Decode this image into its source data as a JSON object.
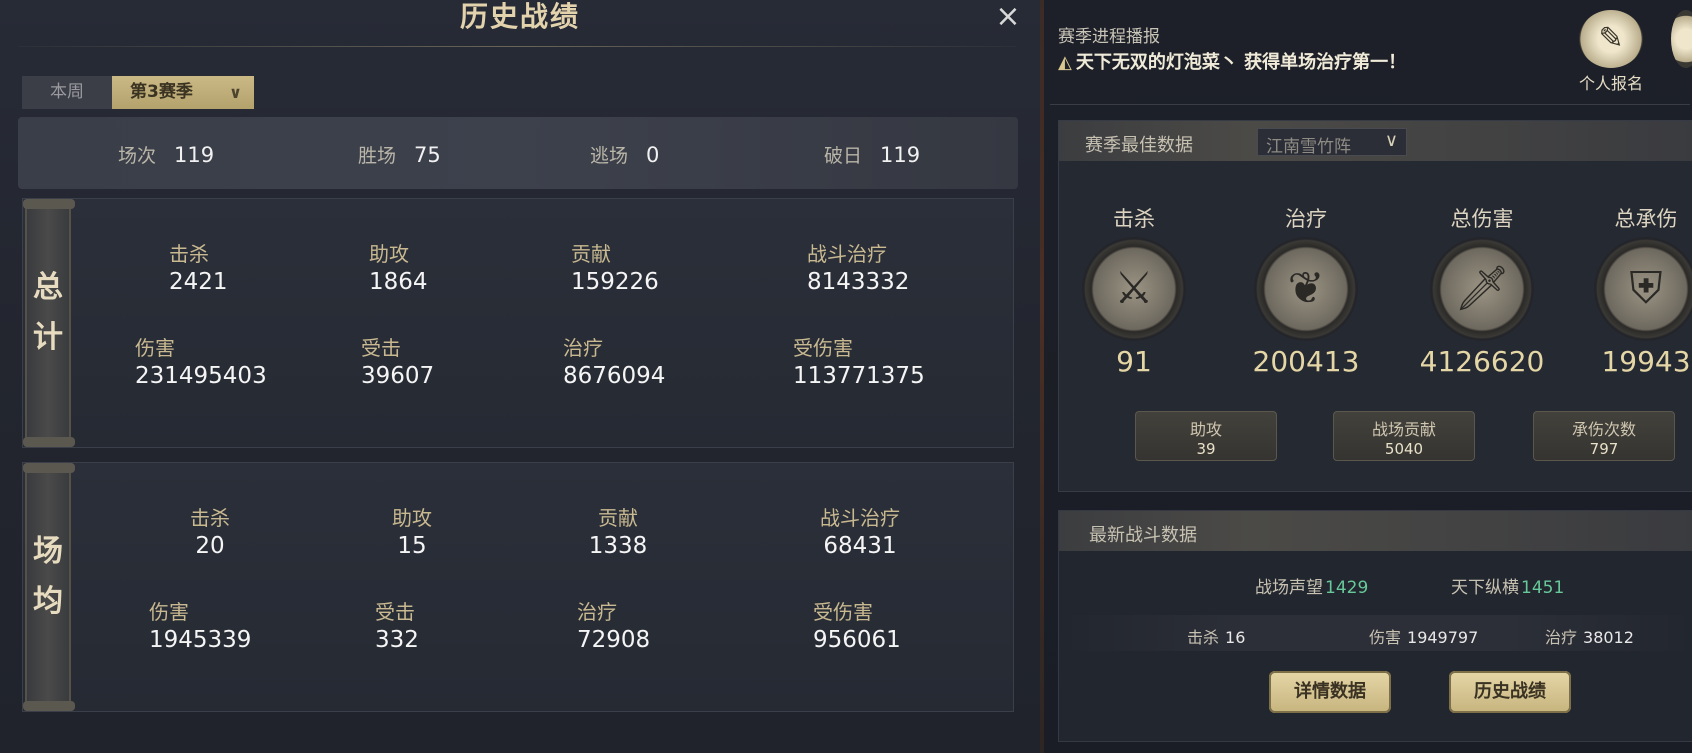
{
  "history": {
    "title": "历史战绩",
    "close_icon": "×",
    "tabs": [
      {
        "label": "本周",
        "active": false
      },
      {
        "label": "第3赛季",
        "active": true
      }
    ],
    "tab_dropdown_icon": "∨",
    "summary": [
      {
        "label": "场次",
        "value": "119"
      },
      {
        "label": "胜场",
        "value": "75"
      },
      {
        "label": "逃场",
        "value": "0"
      },
      {
        "label": "破日",
        "value": "119"
      }
    ],
    "total": {
      "tag": "总计",
      "stats": [
        {
          "label": "击杀",
          "value": "2421"
        },
        {
          "label": "助攻",
          "value": "1864"
        },
        {
          "label": "贡献",
          "value": "159226"
        },
        {
          "label": "战斗治疗",
          "value": "8143332"
        },
        {
          "label": "伤害",
          "value": "231495403"
        },
        {
          "label": "受击",
          "value": "39607"
        },
        {
          "label": "治疗",
          "value": "8676094"
        },
        {
          "label": "受伤害",
          "value": "113771375"
        }
      ]
    },
    "average": {
      "tag": "场均",
      "stats": [
        {
          "label": "击杀",
          "value": "20"
        },
        {
          "label": "助攻",
          "value": "15"
        },
        {
          "label": "贡献",
          "value": "1338"
        },
        {
          "label": "战斗治疗",
          "value": "68431"
        },
        {
          "label": "伤害",
          "value": "1945339"
        },
        {
          "label": "受击",
          "value": "332"
        },
        {
          "label": "治疗",
          "value": "72908"
        },
        {
          "label": "受伤害",
          "value": "956061"
        }
      ]
    }
  },
  "season": {
    "broadcast_title": "赛季进程播报",
    "broadcast_message": "天下无双的灯泡菜丶 获得单场治疗第一！",
    "signup_label": "个人报名",
    "best": {
      "title": "赛季最佳数据",
      "dropdown_value": "江南雪竹阵",
      "medals": [
        {
          "label": "击杀",
          "value": "91",
          "icon": "crossed-swords-icon"
        },
        {
          "label": "治疗",
          "value": "200413",
          "icon": "lotus-icon"
        },
        {
          "label": "总伤害",
          "value": "4126620",
          "icon": "sword-icon"
        },
        {
          "label": "总承伤",
          "value": "19943",
          "icon": "shield-icon"
        }
      ],
      "mini": [
        {
          "label": "助攻",
          "value": "39"
        },
        {
          "label": "战场贡献",
          "value": "5040"
        },
        {
          "label": "承伤次数",
          "value": "797"
        }
      ]
    },
    "latest": {
      "title": "最新战斗数据",
      "reputation": [
        {
          "label": "战场声望",
          "value": "1429"
        },
        {
          "label": "天下纵横",
          "value": "1451"
        }
      ],
      "battle": [
        {
          "label": "击杀",
          "value": "16"
        },
        {
          "label": "伤害",
          "value": "1949797"
        },
        {
          "label": "治疗",
          "value": "38012"
        }
      ],
      "buttons": {
        "details": "详情数据",
        "history": "历史战绩"
      }
    }
  }
}
